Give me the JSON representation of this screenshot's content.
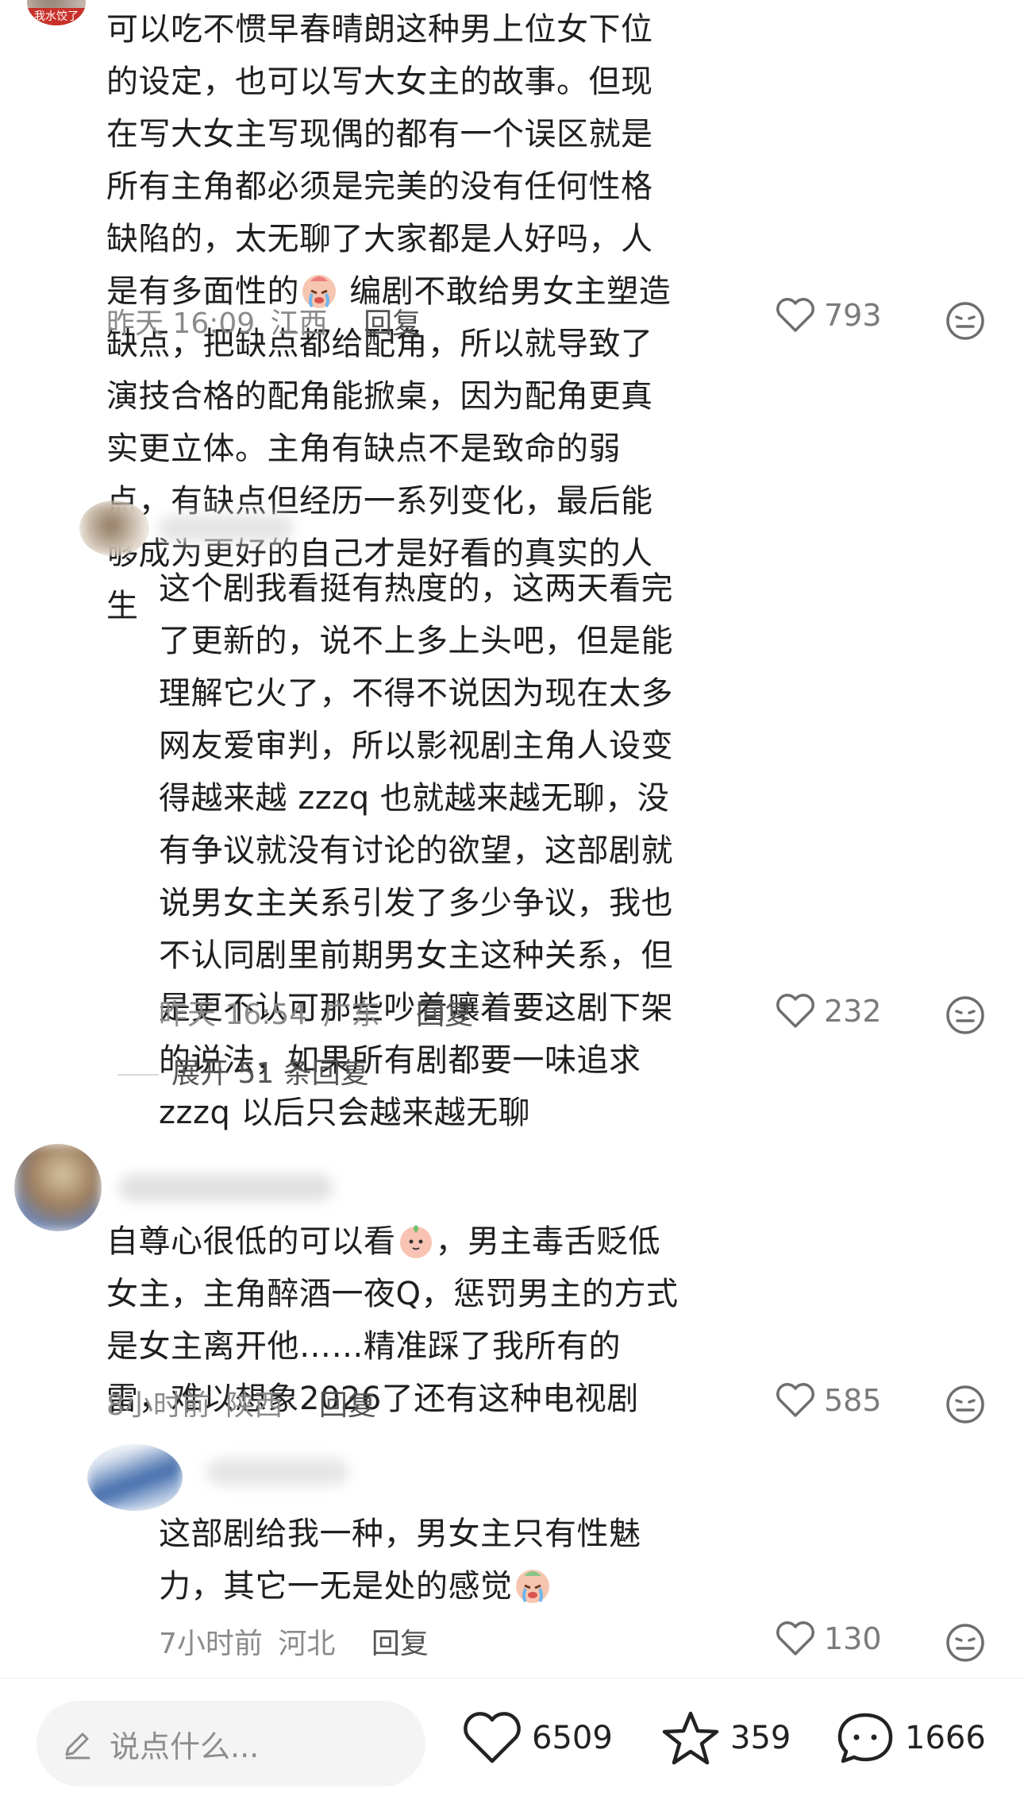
{
  "comments": [
    {
      "avatar_badge": "我水饺了",
      "text": "可以吃不惯早春晴朗这种男上位女下位的设定，也可以写大女主的故事。但现在写大女主写现偶的都有一个误区就是所有主角都必须是完美的没有任何性格缺陷的，太无聊了大家都是人好吗，人是有多面性的",
      "text_after_emoji": " 编剧不敢给男女主塑造缺点，把缺点都给配角，所以就导致了演技合格的配角能掀桌，因为配角更真实更立体。主角有缺点不是致命的弱点，有缺点但经历一系列变化，最后能够成为更好的自己才是好看的真实的人生",
      "time": "昨天 16:09",
      "location": "江西",
      "reply_label": "回复",
      "likes": "793"
    },
    {
      "text": "这个剧我看挺有热度的，这两天看完了更新的，说不上多上头吧，但是能理解它火了，不得不说因为现在太多网友爱审判，所以影视剧主角人设变得越来越 zzzq 也就越来越无聊，没有争议就没有讨论的欲望，这部剧就说男女主关系引发了多少争议，我也不认同剧里前期男女主这种关系，但是更不认可那些吵着嚷着要这剧下架的说法，如果所有剧都要一味追求 zzzq 以后只会越来越无聊",
      "time": "昨天 16:54",
      "location": "广东",
      "reply_label": "回复",
      "likes": "232"
    },
    {
      "text": "自尊心很低的可以看",
      "text_after_emoji": "，男主毒舌贬低女主，主角醉酒一夜Q，惩罚男主的方式是女主离开他……精准踩了我所有的雷，难以想象2026了还有这种电视剧",
      "time": "8小时前",
      "location": "陕西",
      "reply_label": "回复",
      "likes": "585"
    },
    {
      "text": "这部剧给我一种，男女主只有性魅力，其它一无是处的感觉",
      "time": "7小时前",
      "location": "河北",
      "reply_label": "回复",
      "likes": "130"
    }
  ],
  "expand_replies": "展开 51 条回复",
  "bottom_bar": {
    "input_placeholder": "说点什么...",
    "likes": "6509",
    "favorites": "359",
    "comments": "1666"
  },
  "icons": [
    "heart-icon",
    "dislike-face-icon",
    "edit-icon",
    "star-icon",
    "comment-bubble-icon"
  ]
}
